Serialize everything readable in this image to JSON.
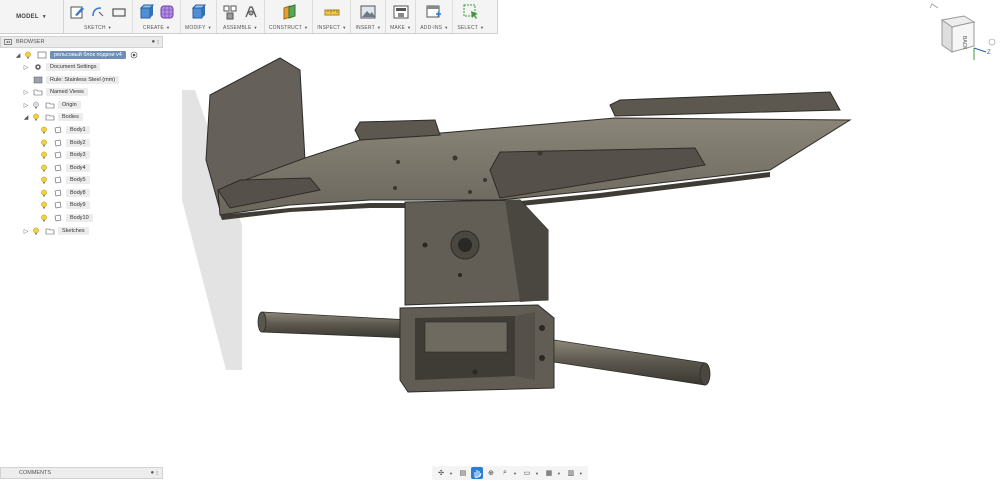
{
  "toolbar": {
    "workspace": "MODEL",
    "groups": [
      {
        "label": "SKETCH"
      },
      {
        "label": "CREATE"
      },
      {
        "label": "MODIFY"
      },
      {
        "label": "ASSEMBLE"
      },
      {
        "label": "CONSTRUCT"
      },
      {
        "label": "INSPECT"
      },
      {
        "label": "INSERT"
      },
      {
        "label": "MAKE"
      },
      {
        "label": "ADD-INS"
      },
      {
        "label": "SELECT"
      }
    ]
  },
  "browser": {
    "title": "BROWSER",
    "root": "рельсовый блок подачи v4",
    "items": {
      "document_settings": "Document Settings",
      "rule": "Rule: Stainless Steel (mm)",
      "named_views": "Named Views",
      "origin": "Origin",
      "bodies": "Bodies",
      "sketches": "Sketches"
    },
    "bodies": [
      "Body1",
      "Body2",
      "Body3",
      "Body4",
      "Body5",
      "Body8",
      "Body9",
      "Body10"
    ]
  },
  "comments": {
    "title": "COMMENTS"
  },
  "viewcube": {
    "face": "BACK",
    "axis_z": "Z"
  },
  "colors": {
    "accent": "#2a7fd4",
    "metal": "#6e6a60",
    "metal_dark": "#4a4740",
    "metal_light": "#8a857a"
  }
}
